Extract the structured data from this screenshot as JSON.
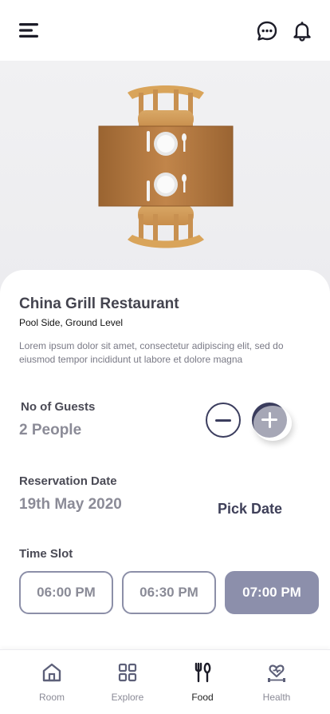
{
  "header": {
    "icons": [
      "menu-icon",
      "chat-icon",
      "bell-icon"
    ]
  },
  "restaurant": {
    "name": "China Grill Restaurant",
    "location": "Pool Side, Ground Level",
    "description": "Lorem ipsum dolor sit amet, consectetur adipiscing elit, sed do eiusmod tempor incididunt ut labore et dolore magna"
  },
  "guests": {
    "label": "No of Guests",
    "value": "2 People"
  },
  "reservation": {
    "label": "Reservation Date",
    "value": "19th May 2020",
    "pick_label": "Pick Date"
  },
  "time_slot": {
    "label": "Time Slot",
    "slots": [
      "06:00 PM",
      "06:30 PM",
      "07:00 PM"
    ],
    "selected": "07:00 PM"
  },
  "nav": {
    "items": [
      {
        "label": "Room",
        "icon": "home-icon"
      },
      {
        "label": "Explore",
        "icon": "grid-icon"
      },
      {
        "label": "Food",
        "icon": "cutlery-icon"
      },
      {
        "label": "Health",
        "icon": "heart-dumbbell-icon"
      }
    ],
    "active": "Food"
  },
  "colors": {
    "accent": "#3b3d5e",
    "selected_slot": "#8c8fab",
    "wood": "#b5793c"
  }
}
